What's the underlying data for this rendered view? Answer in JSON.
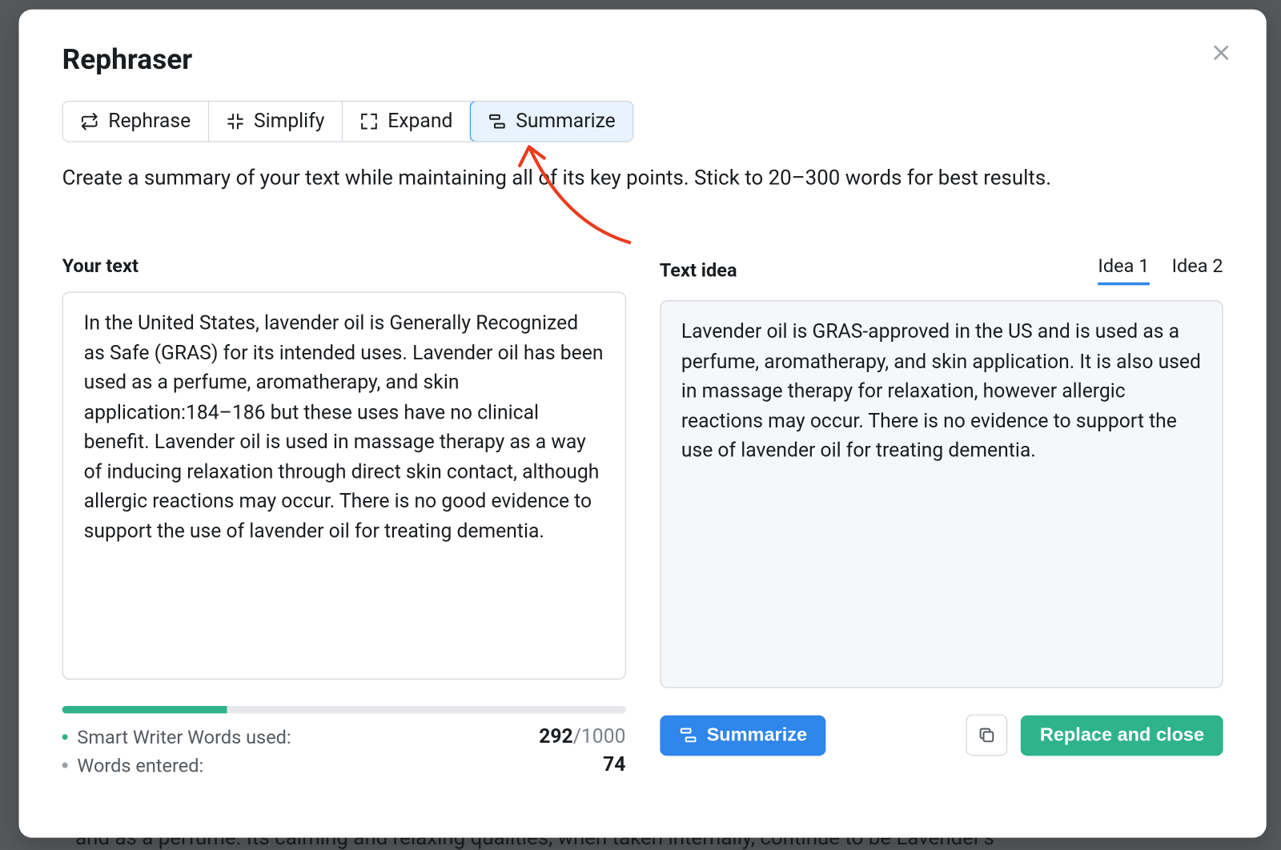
{
  "title": "Rephraser",
  "tabs": {
    "rephrase": "Rephrase",
    "simplify": "Simplify",
    "expand": "Expand",
    "summarize": "Summarize"
  },
  "description": "Create a summary of your text while maintaining all of its key points. Stick to 20–300 words for best results.",
  "left": {
    "title": "Your text",
    "content": "In the United States, lavender oil is Generally Recognized as Safe (GRAS) for its intended uses. Lavender oil has been used as a perfume, aromatherapy, and skin application:184–186 but these uses have no clinical benefit. Lavender oil is used in massage therapy as a way of inducing relaxation through direct skin contact, although allergic reactions may occur. There is no good evidence to support the use of lavender oil for treating dementia."
  },
  "right": {
    "title": "Text idea",
    "ideas": {
      "idea1": "Idea 1",
      "idea2": "Idea 2"
    },
    "content": "Lavender oil is GRAS-approved in the US and is used as a perfume, aromatherapy, and skin application. It is also used in massage therapy for relaxation, however allergic reactions may occur. There is no evidence to support the use of lavender oil for treating dementia."
  },
  "stats": {
    "wordsUsedLabel": "Smart Writer Words used:",
    "wordsUsedVal": "292",
    "wordsUsedMax": "/1000",
    "wordsEnteredLabel": "Words entered:",
    "wordsEnteredVal": "74"
  },
  "buttons": {
    "summarize": "Summarize",
    "replace": "Replace and close"
  },
  "bgText": "and as a perfume. Its calming and relaxing qualities, when taken internally, continue to be Lavender's"
}
